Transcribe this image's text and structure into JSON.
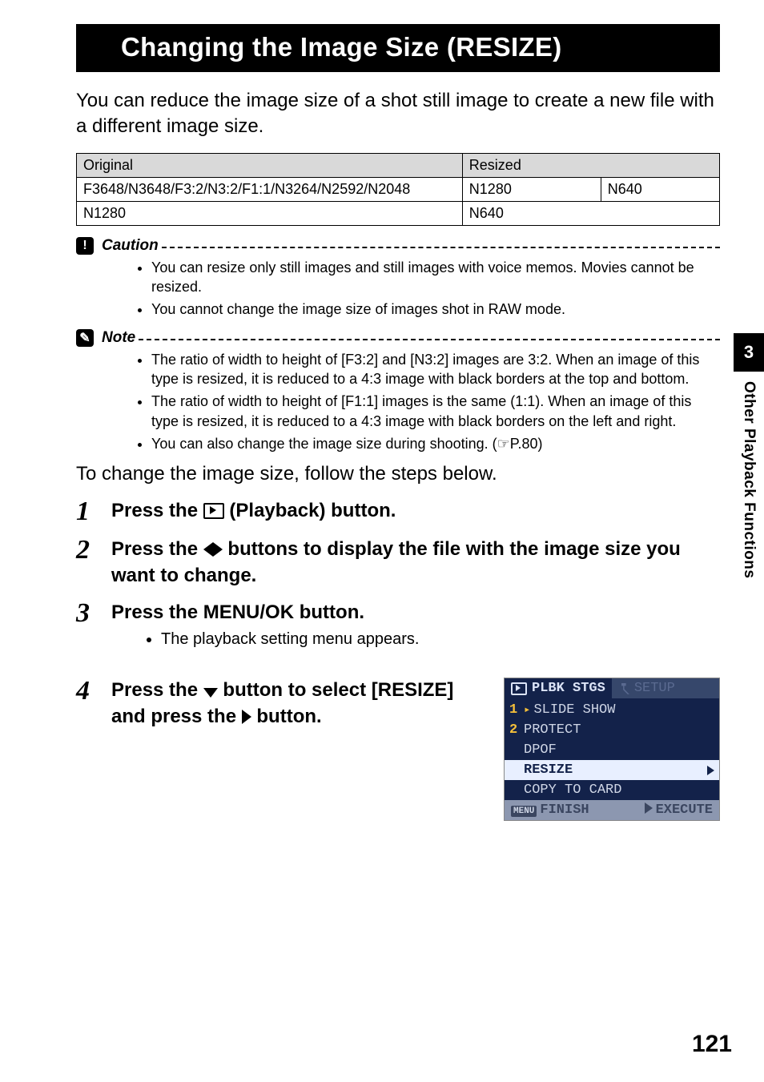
{
  "chapter_number": "3",
  "side_label": "Other Playback Functions",
  "page_number": "121",
  "heading": "Changing the Image Size (RESIZE)",
  "intro": "You can reduce the image size of a shot still image to create a new file with a different image size.",
  "table": {
    "headers": {
      "original": "Original",
      "resized": "Resized"
    },
    "rows": [
      {
        "original": "F3648/N3648/F3:2/N3:2/F1:1/N3264/N2592/N2048",
        "resized1": "N1280",
        "resized2": "N640"
      },
      {
        "original": "N1280",
        "resized1": "N640",
        "resized2": ""
      }
    ]
  },
  "caution_label": "Caution",
  "caution_items": [
    "You can resize only still images and still images with voice memos. Movies cannot be resized.",
    "You cannot change the image size of images shot in RAW mode."
  ],
  "note_label": "Note",
  "note_items": [
    "The ratio of width to height of [F3:2] and [N3:2] images are 3:2. When an image of this type is resized, it is reduced to a 4:3 image with black borders at the top and bottom.",
    "The ratio of width to height of [F1:1] images is the same (1:1). When an image of this type is resized, it is reduced to a 4:3 image with black borders on the left and right.",
    "You can also change the image size during shooting. (☞P.80)"
  ],
  "follow_text": "To change the image size, follow the steps below.",
  "steps": {
    "s1": {
      "num": "1",
      "pre": "Press the ",
      "post": " (Playback) button."
    },
    "s2": {
      "num": "2",
      "pre": "Press the ",
      "post": " buttons to display the file with the image size you want to change."
    },
    "s3": {
      "num": "3",
      "text": "Press the MENU/OK button.",
      "sub": "The playback setting menu appears."
    },
    "s4": {
      "num": "4",
      "pre": "Press the ",
      "mid": " button to select [RESIZE] and press the ",
      "post": " button."
    }
  },
  "menu": {
    "tab_active": "PLBK STGS",
    "tab_inactive": "SETUP",
    "items": [
      {
        "n": "1",
        "label": "SLIDE SHOW"
      },
      {
        "n": "2",
        "label": "PROTECT"
      },
      {
        "n": "",
        "label": "DPOF"
      },
      {
        "n": "",
        "label": "RESIZE",
        "selected": true
      },
      {
        "n": "",
        "label": "COPY TO CARD"
      }
    ],
    "bottom_left_tag": "MENU",
    "bottom_left": "FINISH",
    "bottom_right": "EXECUTE"
  }
}
